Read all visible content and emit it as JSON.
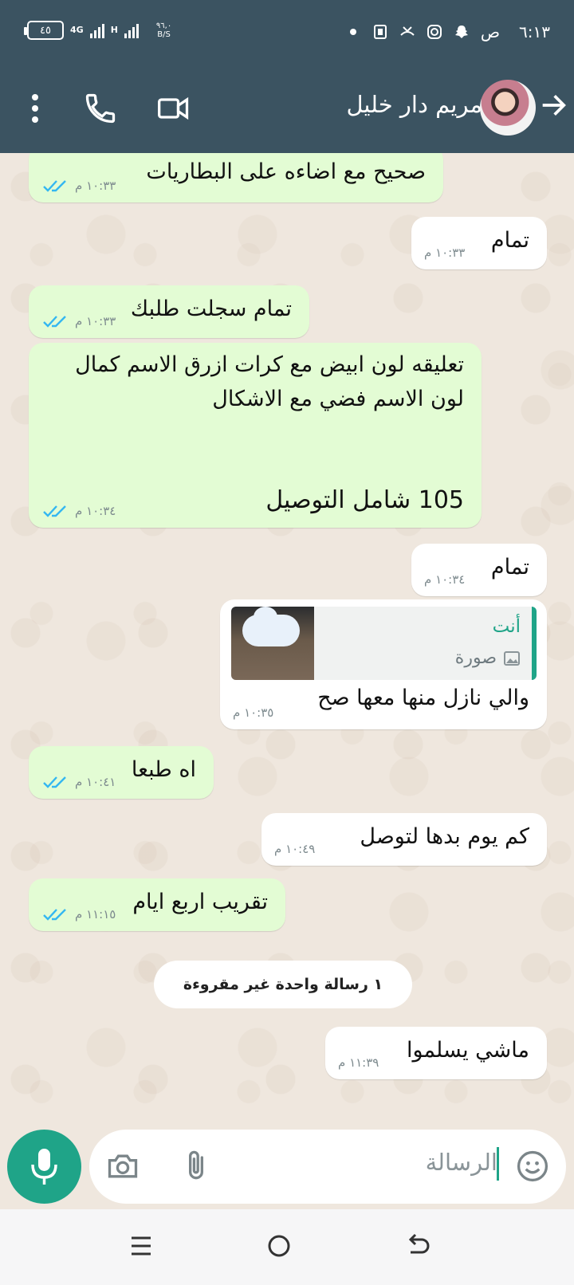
{
  "status_bar": {
    "time": "٦:١٣",
    "ampm": "ص",
    "battery": "٤٥",
    "network_type": "4G",
    "network_sub": "H",
    "speed_value": "٩٦,٠",
    "speed_unit": "B/S"
  },
  "header": {
    "contact_name": "مريم دار خليل"
  },
  "messages": [
    {
      "dir": "out",
      "text": "صحيح مع اضاءه على البطاريات",
      "time": "١٠:٣٣ م",
      "read": true
    },
    {
      "dir": "in",
      "text": "تمام",
      "time": "١٠:٣٣ م"
    },
    {
      "dir": "out",
      "text": "تمام سجلت طلبك",
      "time": "١٠:٣٣ م",
      "read": true
    },
    {
      "dir": "out",
      "lines": [
        "تعليقه لون ابيض مع كرات ازرق الاسم كمال",
        "لون الاسم فضي مع الاشكال",
        "105 شامل التوصيل"
      ],
      "time": "١٠:٣٤ م",
      "read": true
    },
    {
      "dir": "in",
      "text": "تمام",
      "time": "١٠:٣٤ م"
    },
    {
      "dir": "in",
      "reply_sender": "أنت",
      "reply_type": "صورة",
      "text": "والي نازل منها معها صح",
      "time": "١٠:٣٥ م"
    },
    {
      "dir": "out",
      "text": "اه طبعا",
      "time": "١٠:٤١ م",
      "read": true
    },
    {
      "dir": "in",
      "text": "كم يوم بدها لتوصل",
      "time": "١٠:٤٩ م"
    },
    {
      "dir": "out",
      "text": "تقريب اربع ايام",
      "time": "١١:١٥ م",
      "read": true
    },
    {
      "dir": "in",
      "text": "ماشي يسلموا",
      "time": "١١:٣٩ م"
    }
  ],
  "unread_banner": "١ رسالة واحدة غير مقروءة",
  "composer": {
    "placeholder": "الرسالة"
  },
  "colors": {
    "header": "#3b5361",
    "outgoing_bubble": "#e3fcd4",
    "incoming_bubble": "#ffffff",
    "accent": "#1fa488",
    "read_ticks": "#34b7f1",
    "chat_bg": "#efe7de"
  },
  "icons": [
    "more-vert-icon",
    "phone-icon",
    "video-icon",
    "back-arrow-icon",
    "mic-icon",
    "camera-icon",
    "attach-icon",
    "emoji-icon",
    "image-icon",
    "double-check-icon",
    "menu-nav-icon",
    "home-nav-icon",
    "back-nav-icon"
  ]
}
